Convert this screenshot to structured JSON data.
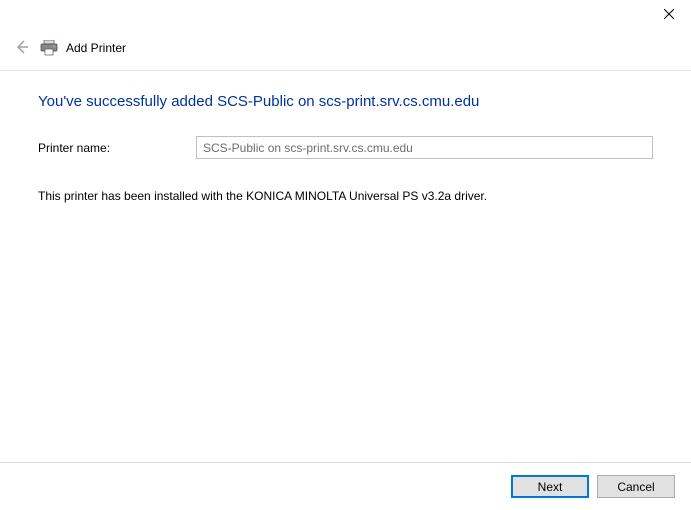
{
  "header": {
    "title": "Add Printer"
  },
  "content": {
    "heading": "You've successfully added SCS-Public on scs-print.srv.cs.cmu.edu",
    "printer_name_label": "Printer name:",
    "printer_name_value": "SCS-Public on scs-print.srv.cs.cmu.edu",
    "status_text": "This printer has been installed with the KONICA MINOLTA Universal PS v3.2a driver."
  },
  "footer": {
    "next_label": "Next",
    "cancel_label": "Cancel"
  }
}
